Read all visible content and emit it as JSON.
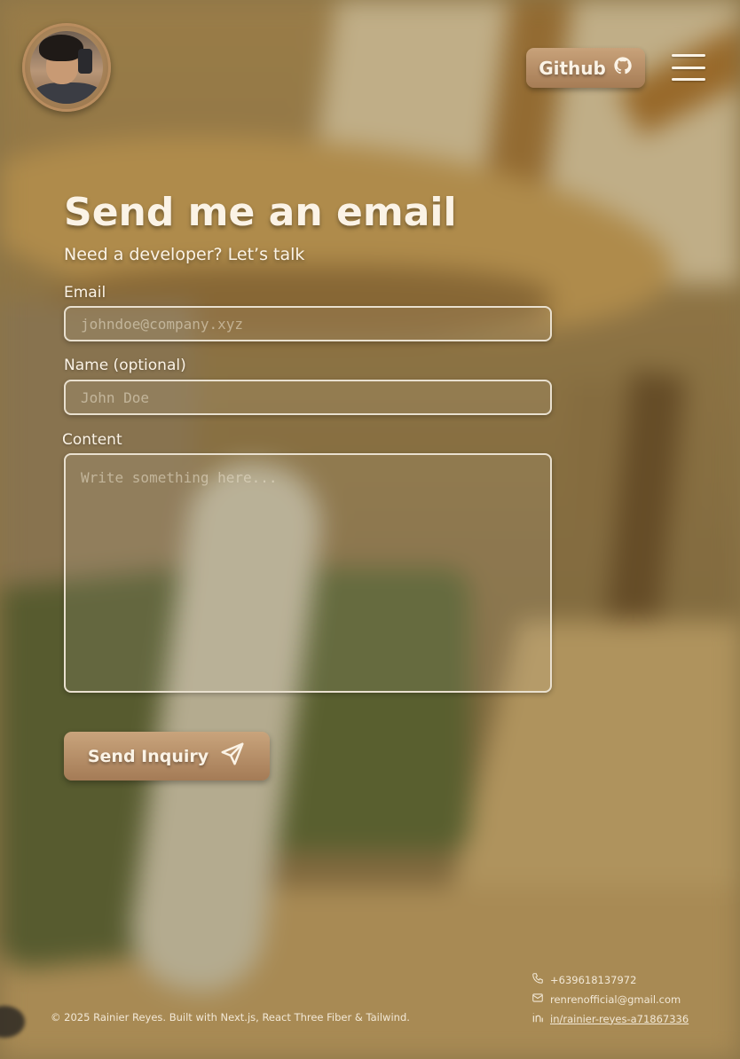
{
  "header": {
    "github_label": "Github",
    "avatar_alt": "profile photo"
  },
  "form": {
    "title": "Send me an email",
    "subtitle": "Need a developer? Let’s talk",
    "email_label": "Email",
    "email_placeholder": "johndoe@company.xyz",
    "email_value": "",
    "name_label": "Name (optional)",
    "name_placeholder": "John Doe",
    "name_value": "",
    "content_label": "Content",
    "content_placeholder": "Write something here...",
    "content_value": "",
    "submit_label": "Send Inquiry"
  },
  "footer": {
    "copyright": "© 2025 Rainier Reyes. Built with Next.js, React Three Fiber & Tailwind.",
    "phone": "+639618137972",
    "email": "renrenofficial@gmail.com",
    "linkedin": "in/rainier-reyes-a71867336"
  },
  "colors": {
    "accent": "#b98d5f",
    "text": "#fbf3e6"
  },
  "icons": [
    "github-icon",
    "menu-icon",
    "send-icon",
    "phone-icon",
    "mail-icon",
    "linkedin-icon"
  ]
}
